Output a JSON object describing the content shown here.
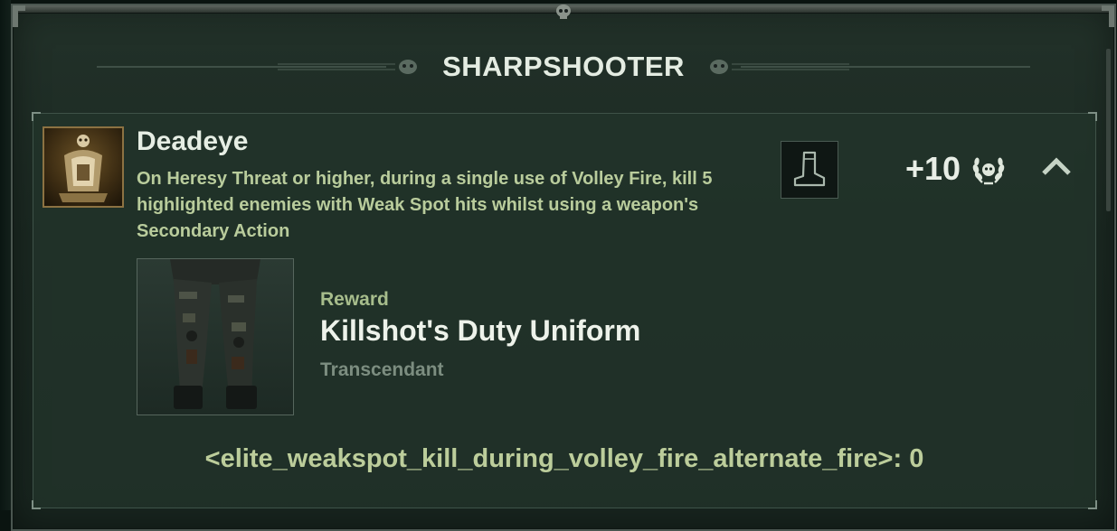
{
  "header": {
    "title": "SHARPSHOOTER"
  },
  "achievement": {
    "title": "Deadeye",
    "description": "On Heresy Threat or higher, during a single use of Volley Fire, kill 5 highlighted enemies with Weak Spot hits whilst using a weapon's Secondary Action",
    "icon": "skull-portrait-icon",
    "category_icon": "boot-icon",
    "points": "+10",
    "points_icon": "laurel-wreath-icon",
    "collapse_icon": "chevron-up-icon"
  },
  "reward": {
    "label": "Reward",
    "name": "Killshot's Duty Uniform",
    "rarity": "Transcendant",
    "image": "uniform-legs-icon"
  },
  "progress": {
    "text": "<elite_weakspot_kill_during_volley_fire_alternate_fire>: 0"
  },
  "colors": {
    "background": "#1b2922",
    "accent_text": "#b9cc9c",
    "title_text": "#e6eee4",
    "rarity_text": "#7c8d80"
  }
}
